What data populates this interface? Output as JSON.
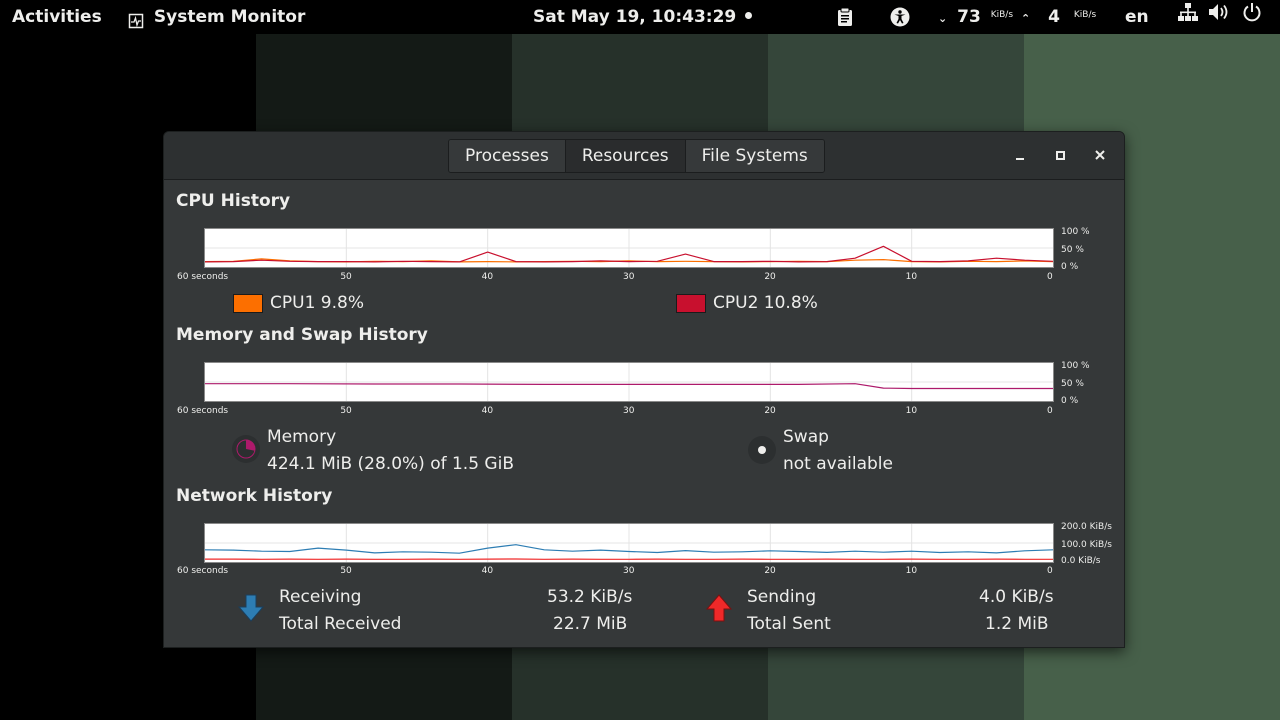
{
  "topbar": {
    "activities": "Activities",
    "app_name": "System Monitor",
    "clock": "Sat May 19, 10:43:29",
    "net_down_value": "73",
    "net_down_unit": "KiB/s",
    "net_up_value": "4",
    "net_up_unit": "KiB/s",
    "keyboard_layout": "en"
  },
  "wallpaper_colors": [
    "#000000",
    "#141a16",
    "#26312a",
    "#35463a",
    "#47604a"
  ],
  "window": {
    "tabs": [
      "Processes",
      "Resources",
      "File Systems"
    ],
    "active_tab": 1
  },
  "cpu": {
    "title": "CPU History",
    "ylabels": [
      "100 %",
      "50 %",
      "0 %"
    ],
    "cpu1_label": "CPU1 9.8%",
    "cpu2_label": "CPU2 10.8%",
    "cpu1_color": "#fc6f00",
    "cpu2_color": "#c8102e"
  },
  "memory": {
    "title": "Memory and Swap History",
    "ylabels": [
      "100 %",
      "50 %",
      "0 %"
    ],
    "memory_label": "Memory",
    "memory_value": "424.1 MiB (28.0%) of 1.5 GiB",
    "memory_percent": 28.0,
    "memory_color": "#ad1a6b",
    "swap_label": "Swap",
    "swap_value": "not available"
  },
  "network": {
    "title": "Network History",
    "ylabels": [
      "200.0 KiB/s",
      "100.0 KiB/s",
      "0.0 KiB/s"
    ],
    "receiving_label": "Receiving",
    "receiving_value": "53.2 KiB/s",
    "total_received_label": "Total Received",
    "total_received_value": "22.7 MiB",
    "sending_label": "Sending",
    "sending_value": "4.0 KiB/s",
    "total_sent_label": "Total Sent",
    "total_sent_value": "1.2 MiB",
    "receive_color": "#2d7db3",
    "send_color": "#ef2929"
  },
  "xlabels": [
    "60 seconds",
    "50",
    "40",
    "30",
    "20",
    "10",
    "0"
  ],
  "chart_data": [
    {
      "type": "line",
      "title": "CPU History",
      "xlabel": "",
      "ylabel": "",
      "ylim": [
        0,
        100
      ],
      "x": [
        60,
        58,
        56,
        54,
        52,
        50,
        48,
        46,
        44,
        42,
        40,
        38,
        36,
        34,
        32,
        30,
        28,
        26,
        24,
        22,
        20,
        18,
        16,
        14,
        12,
        10,
        8,
        6,
        4,
        2,
        0
      ],
      "series": [
        {
          "name": "CPU1 9.8%",
          "values": [
            10,
            11,
            18,
            12,
            10,
            9,
            11,
            10,
            12,
            9,
            10,
            9,
            10,
            11,
            10,
            12,
            10,
            11,
            10,
            9,
            10,
            11,
            10,
            14,
            16,
            10,
            9,
            11,
            10,
            12,
            10
          ]
        },
        {
          "name": "CPU2 10.8%",
          "values": [
            9,
            10,
            14,
            11,
            10,
            10,
            9,
            11,
            10,
            9,
            38,
            10,
            9,
            10,
            12,
            10,
            11,
            32,
            10,
            10,
            11,
            9,
            10,
            20,
            55,
            11,
            10,
            12,
            20,
            14,
            11
          ]
        }
      ]
    },
    {
      "type": "line",
      "title": "Memory and Swap History",
      "xlabel": "",
      "ylabel": "",
      "ylim": [
        0,
        100
      ],
      "x": [
        60,
        54,
        48,
        42,
        36,
        30,
        24,
        18,
        14,
        12,
        10,
        6,
        0
      ],
      "series": [
        {
          "name": "Memory",
          "values": [
            45,
            45,
            44,
            44,
            43,
            43,
            43,
            43,
            45,
            32,
            31,
            31,
            31
          ]
        }
      ]
    },
    {
      "type": "line",
      "title": "Network History",
      "xlabel": "",
      "ylabel": "",
      "ylim": [
        0,
        200
      ],
      "x": [
        60,
        58,
        56,
        54,
        52,
        50,
        48,
        46,
        44,
        42,
        40,
        38,
        36,
        34,
        32,
        30,
        28,
        26,
        24,
        22,
        20,
        18,
        16,
        14,
        12,
        10,
        8,
        6,
        4,
        2,
        0
      ],
      "series": [
        {
          "name": "Receiving",
          "values": [
            60,
            58,
            52,
            50,
            70,
            58,
            42,
            48,
            46,
            40,
            70,
            90,
            60,
            52,
            58,
            50,
            44,
            55,
            46,
            48,
            54,
            50,
            45,
            52,
            46,
            52,
            44,
            48,
            42,
            54,
            60
          ]
        },
        {
          "name": "Sending",
          "values": [
            5,
            5,
            4,
            5,
            4,
            5,
            4,
            4,
            5,
            4,
            5,
            6,
            4,
            5,
            4,
            4,
            5,
            4,
            4,
            5,
            4,
            4,
            5,
            4,
            4,
            5,
            4,
            4,
            5,
            4,
            4
          ]
        }
      ]
    }
  ]
}
